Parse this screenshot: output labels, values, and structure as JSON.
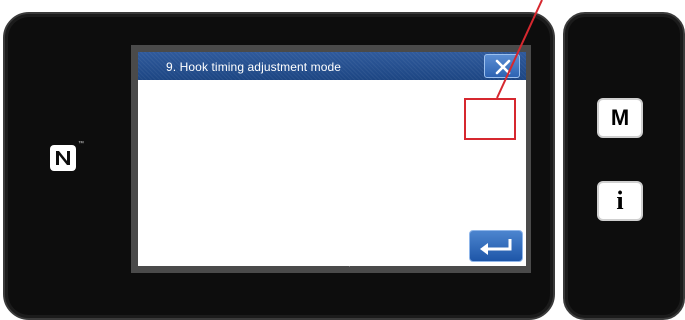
{
  "dialog": {
    "title": "9. Hook timing adjustment mode",
    "timing_value": "",
    "close_icon": "close-icon",
    "enter_icon": "enter-arrow-icon"
  },
  "side_panel": {
    "mode_button_label": "M",
    "info_button_label": "i"
  },
  "nfc": {
    "icon": "nfc-icon",
    "trademark": "™"
  },
  "colors": {
    "title_bar": "#1f4a88",
    "highlight": "#d6282f",
    "bezel": "#0d0d0d"
  }
}
